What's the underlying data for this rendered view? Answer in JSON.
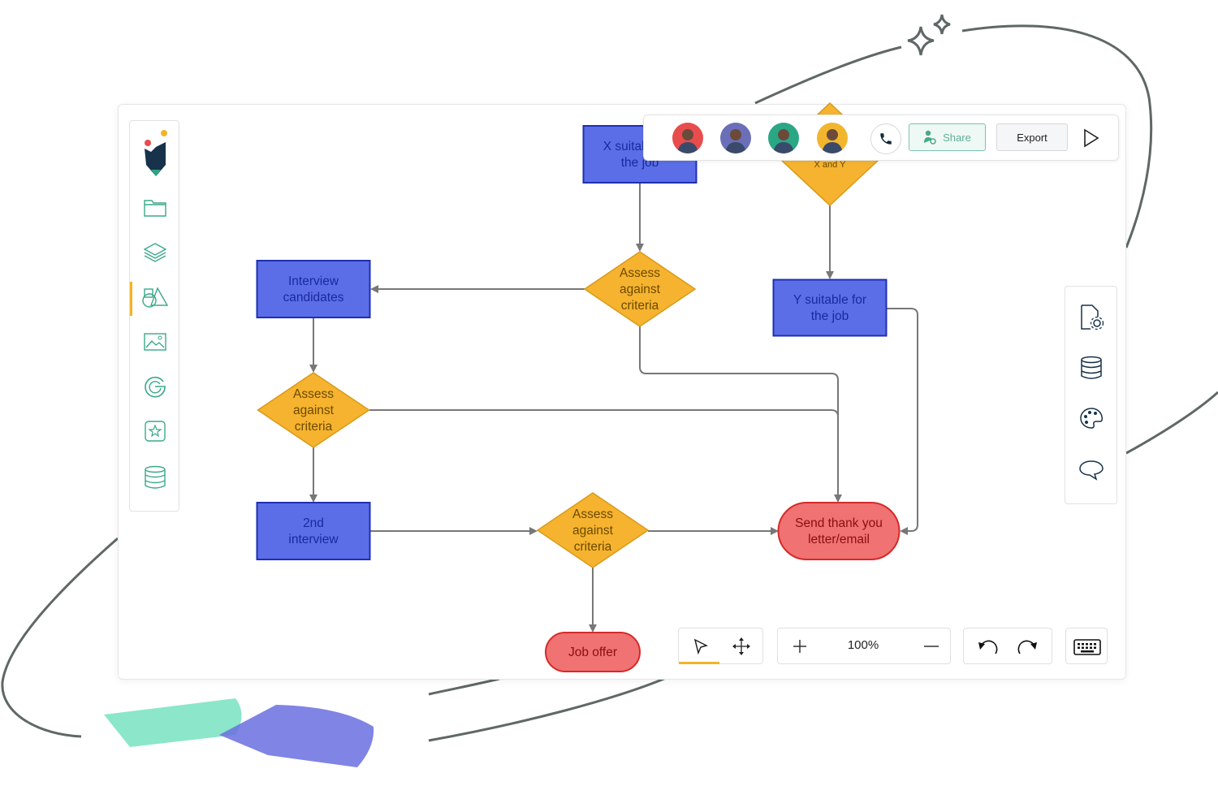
{
  "app": {
    "collaborators": [
      "Collaborator 1",
      "Collaborator 2",
      "Collaborator 3",
      "Collaborator 4"
    ],
    "avatar_colors": [
      "#e84c4c",
      "#6a6fb8",
      "#2aa784",
      "#f2b62e"
    ],
    "share_label": "Share",
    "export_label": "Export",
    "zoom_level": "100%"
  },
  "left_toolbar": {
    "items": [
      "folder-icon",
      "layers-icon",
      "shapes-icon",
      "image-icon",
      "google-icon",
      "sticker-icon",
      "database-icon"
    ],
    "active": "shapes-icon"
  },
  "right_toolbar": {
    "items": [
      "page-settings-icon",
      "database-icon",
      "palette-icon",
      "comment-icon"
    ]
  },
  "diagram": {
    "nodes": {
      "x_suitable": [
        "X suitable for",
        "the job"
      ],
      "x_and_y": [
        "X and Y"
      ],
      "assess1": [
        "Assess",
        "against",
        "criteria"
      ],
      "interview": [
        "Interview",
        "candidates"
      ],
      "y_suitable": [
        "Y suitable for",
        "the job"
      ],
      "assess2": [
        "Assess",
        "against",
        "criteria"
      ],
      "second_interview": [
        "2nd",
        "interview"
      ],
      "assess3": [
        "Assess",
        "against",
        "criteria"
      ],
      "thank_you": [
        "Send thank you",
        "letter/email"
      ],
      "job_offer": [
        "Job offer"
      ]
    },
    "colors": {
      "process_fill": "#5b6ee8",
      "process_border": "#1f2fb0",
      "process_text": "#1a2a9c",
      "decision_fill": "#f6b32f",
      "decision_border": "#d99a1a",
      "decision_text": "#6b4a00",
      "terminal_fill": "#f07272",
      "terminal_border": "#d42a2a",
      "terminal_text": "#8a0f0f",
      "connector": "#777777",
      "accent": "#f0b429"
    }
  }
}
